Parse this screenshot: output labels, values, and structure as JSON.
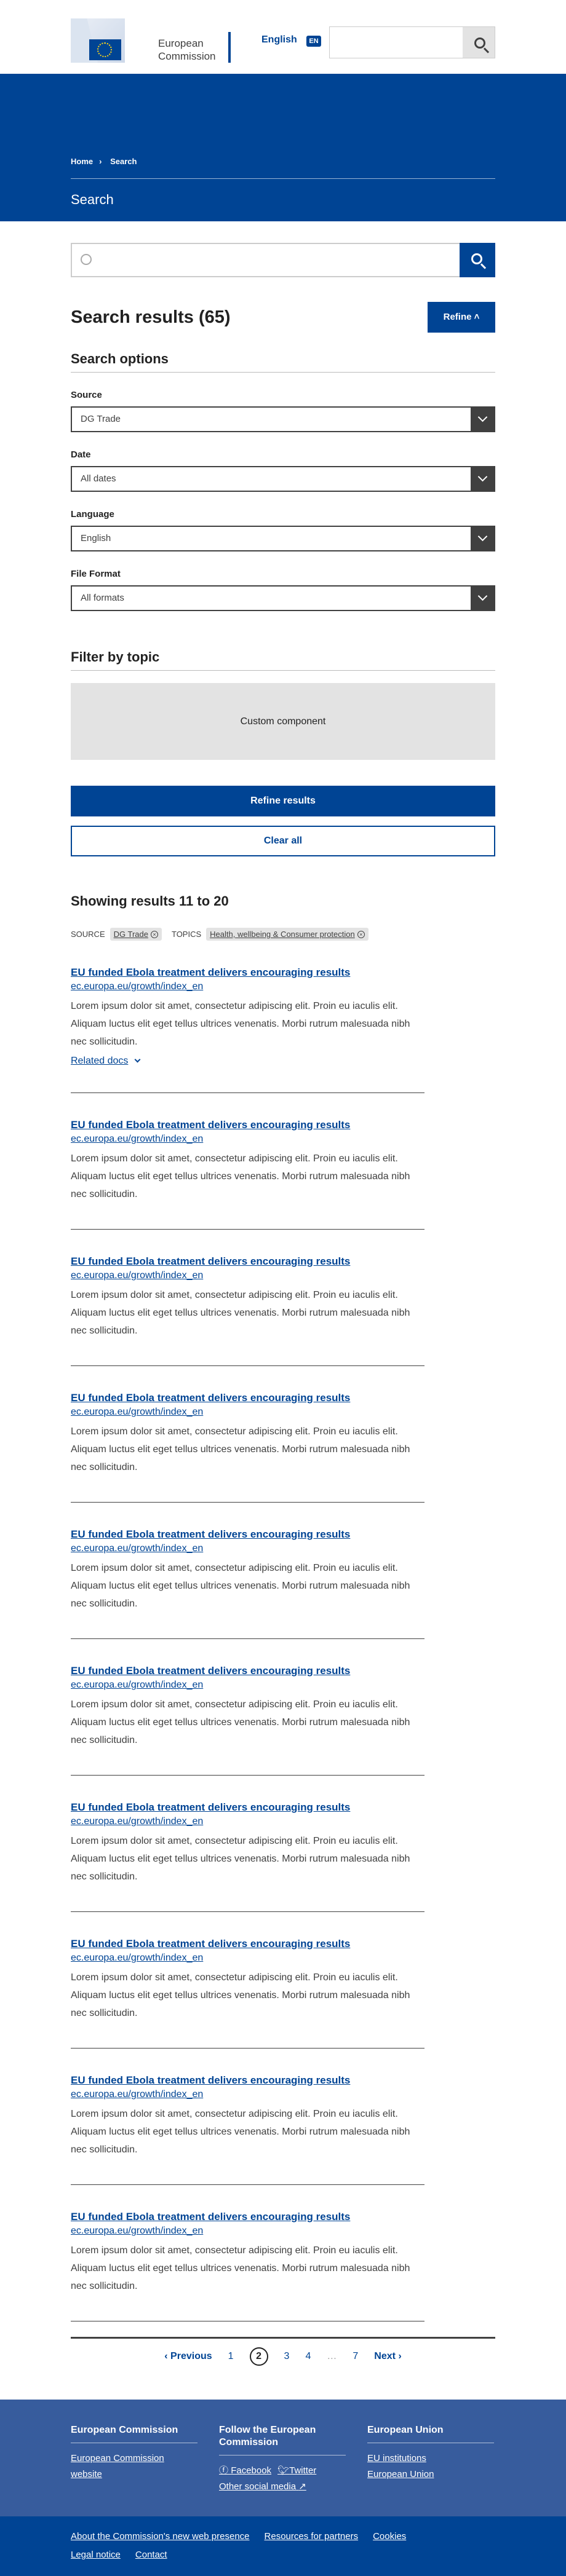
{
  "header": {
    "logo_line1": "European",
    "logo_line2": "Commission",
    "language": "English",
    "language_code": "EN"
  },
  "breadcrumb": [
    "Home",
    "Search"
  ],
  "page_title": "Search",
  "results_title": "Search results (65)",
  "refine_label": "Refine",
  "search_options_title": "Search options",
  "filters": [
    {
      "label": "Source",
      "value": "DG Trade"
    },
    {
      "label": "Date",
      "value": "All dates"
    },
    {
      "label": "Language",
      "value": "English"
    },
    {
      "label": "File Format",
      "value": "All formats"
    }
  ],
  "filter_by_topic_title": "Filter by topic",
  "custom_component_label": "Custom component",
  "refine_results_label": "Refine results",
  "clear_all_label": "Clear all",
  "showing_label": "Showing results 11 to 20",
  "active_filters": {
    "source_label": "SOURCE",
    "source_value": "DG Trade",
    "topics_label": "TOPICS",
    "topics_value": "Health, wellbeing & Consumer protection"
  },
  "results": [
    {
      "title": "EU funded Ebola treatment delivers encouraging results",
      "url": "ec.europa.eu/growth/index_en",
      "desc": "Lorem ipsum dolor sit amet, consectetur adipiscing elit. Proin eu iaculis elit. Aliquam luctus elit eget tellus ultrices venenatis. Morbi rutrum malesuada nibh nec sollicitudin.",
      "related": "Related docs"
    },
    {
      "title": "EU funded Ebola treatment delivers encouraging results",
      "url": "ec.europa.eu/growth/index_en",
      "desc": "Lorem ipsum dolor sit amet, consectetur adipiscing elit. Proin eu iaculis elit. Aliquam luctus elit eget tellus ultrices venenatis. Morbi rutrum malesuada nibh nec sollicitudin."
    },
    {
      "title": "EU funded Ebola treatment delivers encouraging results",
      "url": "ec.europa.eu/growth/index_en",
      "desc": "Lorem ipsum dolor sit amet, consectetur adipiscing elit. Proin eu iaculis elit. Aliquam luctus elit eget tellus ultrices venenatis. Morbi rutrum malesuada nibh nec sollicitudin."
    },
    {
      "title": "EU funded Ebola treatment delivers encouraging results",
      "url": "ec.europa.eu/growth/index_en",
      "desc": "Lorem ipsum dolor sit amet, consectetur adipiscing elit. Proin eu iaculis elit. Aliquam luctus elit eget tellus ultrices venenatis. Morbi rutrum malesuada nibh nec sollicitudin."
    },
    {
      "title": "EU funded Ebola treatment delivers encouraging results",
      "url": "ec.europa.eu/growth/index_en",
      "desc": "Lorem ipsum dolor sit amet, consectetur adipiscing elit. Proin eu iaculis elit. Aliquam luctus elit eget tellus ultrices venenatis. Morbi rutrum malesuada nibh nec sollicitudin."
    },
    {
      "title": "EU funded Ebola treatment delivers encouraging results",
      "url": "ec.europa.eu/growth/index_en",
      "desc": "Lorem ipsum dolor sit amet, consectetur adipiscing elit. Proin eu iaculis elit. Aliquam luctus elit eget tellus ultrices venenatis. Morbi rutrum malesuada nibh nec sollicitudin."
    },
    {
      "title": "EU funded Ebola treatment delivers encouraging results",
      "url": "ec.europa.eu/growth/index_en",
      "desc": "Lorem ipsum dolor sit amet, consectetur adipiscing elit. Proin eu iaculis elit. Aliquam luctus elit eget tellus ultrices venenatis. Morbi rutrum malesuada nibh nec sollicitudin."
    },
    {
      "title": "EU funded Ebola treatment delivers encouraging results",
      "url": "ec.europa.eu/growth/index_en",
      "desc": "Lorem ipsum dolor sit amet, consectetur adipiscing elit. Proin eu iaculis elit. Aliquam luctus elit eget tellus ultrices venenatis. Morbi rutrum malesuada nibh nec sollicitudin."
    },
    {
      "title": "EU funded Ebola treatment delivers encouraging results",
      "url": "ec.europa.eu/growth/index_en",
      "desc": "Lorem ipsum dolor sit amet, consectetur adipiscing elit. Proin eu iaculis elit. Aliquam luctus elit eget tellus ultrices venenatis. Morbi rutrum malesuada nibh nec sollicitudin."
    },
    {
      "title": "EU funded Ebola treatment delivers encouraging results",
      "url": "ec.europa.eu/growth/index_en",
      "desc": "Lorem ipsum dolor sit amet, consectetur adipiscing elit. Proin eu iaculis elit. Aliquam luctus elit eget tellus ultrices venenatis. Morbi rutrum malesuada nibh nec sollicitudin."
    }
  ],
  "pagination": {
    "prev": "‹ Previous",
    "pages": [
      "1",
      "2",
      "3",
      "4",
      "…",
      "7"
    ],
    "current": "2",
    "next": "Next ›"
  },
  "footer": {
    "col1_title": "European Commission",
    "col1_link": "European Commission website",
    "col2_title": "Follow the European Commission",
    "col2_facebook": "Facebook",
    "col2_twitter": "Twitter",
    "col2_other": "Other social media",
    "col3_title": "European Union",
    "col3_link1": "EU institutions",
    "col3_link2": "European Union",
    "bottom_links": [
      "About the Commission's new web presence",
      "Resources for partners",
      "Cookies",
      "Legal notice",
      "Contact"
    ]
  },
  "colors": {
    "primary": "#004494",
    "footer_light": "#375c9d",
    "text": "#404040"
  },
  "icons": [
    "eu-flag-logo",
    "search-icon",
    "chevron-down-icon",
    "chevron-up-icon",
    "close-icon",
    "facebook-icon",
    "twitter-icon",
    "external-link-icon"
  ]
}
